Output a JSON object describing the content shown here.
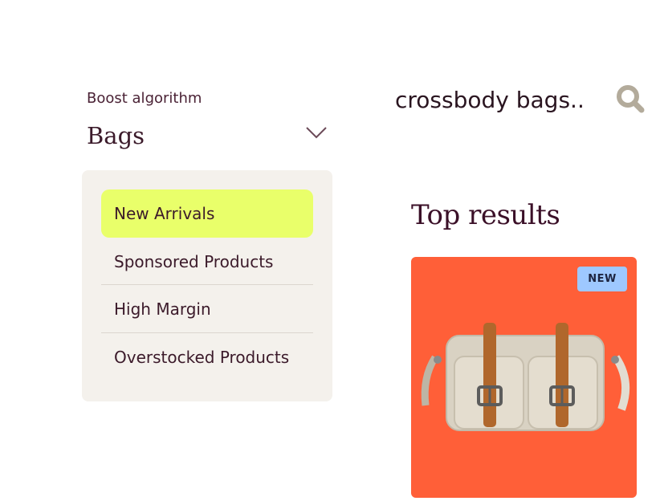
{
  "filter": {
    "label": "Boost algorithm",
    "selected_value": "Bags",
    "options": [
      {
        "label": "New Arrivals",
        "selected": true
      },
      {
        "label": "Sponsored Products",
        "selected": false
      },
      {
        "label": "High Margin",
        "selected": false
      },
      {
        "label": "Overstocked Products",
        "selected": false
      }
    ]
  },
  "search": {
    "query": "crossbody bags.."
  },
  "results": {
    "title": "Top results",
    "product": {
      "badge": "NEW"
    }
  },
  "colors": {
    "highlight": "#e9ff6a",
    "panel": "#f4f1ec",
    "card": "#ff5f38",
    "badge": "#9ec8ff",
    "text": "#3b1a2a"
  },
  "icons": {
    "chevron": "chevron-down-icon",
    "search": "search-icon"
  }
}
